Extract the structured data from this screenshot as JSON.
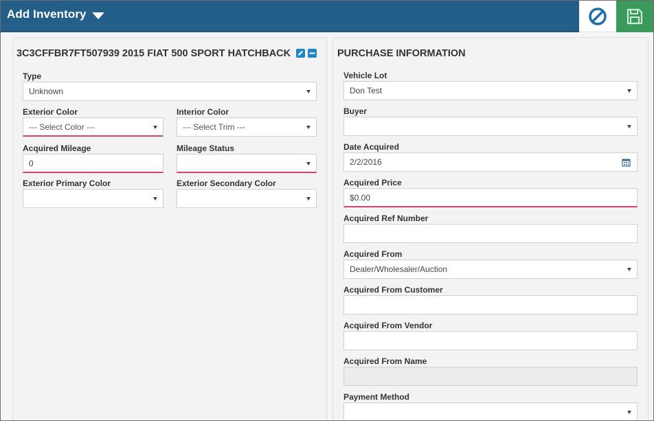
{
  "header": {
    "title": "Add Inventory",
    "accent": "#245f89",
    "cancel_icon": "ban-icon",
    "save_icon": "floppy-disk-icon",
    "save_color": "#3a9a5a"
  },
  "vehicle": {
    "title": "3C3CFFBR7FT507939 2015 FIAT 500 SPORT HATCHBACK",
    "edit_icon": "pencil-icon",
    "collapse_icon": "minus-icon",
    "fields": {
      "type": {
        "label": "Type",
        "value": "Unknown"
      },
      "exterior_color": {
        "label": "Exterior Color",
        "value": "--- Select Color ---"
      },
      "interior_color": {
        "label": "Interior Color",
        "value": "--- Select Trim ---"
      },
      "acquired_mileage": {
        "label": "Acquired Mileage",
        "value": "0"
      },
      "mileage_status": {
        "label": "Mileage Status",
        "value": ""
      },
      "exterior_primary_color": {
        "label": "Exterior Primary Color",
        "value": ""
      },
      "exterior_secondary_color": {
        "label": "Exterior Secondary Color",
        "value": ""
      }
    }
  },
  "purchase": {
    "title": "PURCHASE INFORMATION",
    "fields": {
      "vehicle_lot": {
        "label": "Vehicle Lot",
        "value": "Don Test"
      },
      "buyer": {
        "label": "Buyer",
        "value": ""
      },
      "date_acquired": {
        "label": "Date Acquired",
        "value": "2/2/2016"
      },
      "acquired_price": {
        "label": "Acquired Price",
        "value": "$0.00"
      },
      "acquired_ref_number": {
        "label": "Acquired Ref Number",
        "value": ""
      },
      "acquired_from": {
        "label": "Acquired From",
        "value": "Dealer/Wholesaler/Auction"
      },
      "acquired_from_customer": {
        "label": "Acquired From Customer",
        "value": ""
      },
      "acquired_from_vendor": {
        "label": "Acquired From Vendor",
        "value": ""
      },
      "acquired_from_name": {
        "label": "Acquired From Name",
        "value": ""
      },
      "payment_method": {
        "label": "Payment Method",
        "value": ""
      }
    }
  },
  "colors": {
    "required_underline": "#d2436a",
    "icon_blue": "#1f86c8"
  }
}
